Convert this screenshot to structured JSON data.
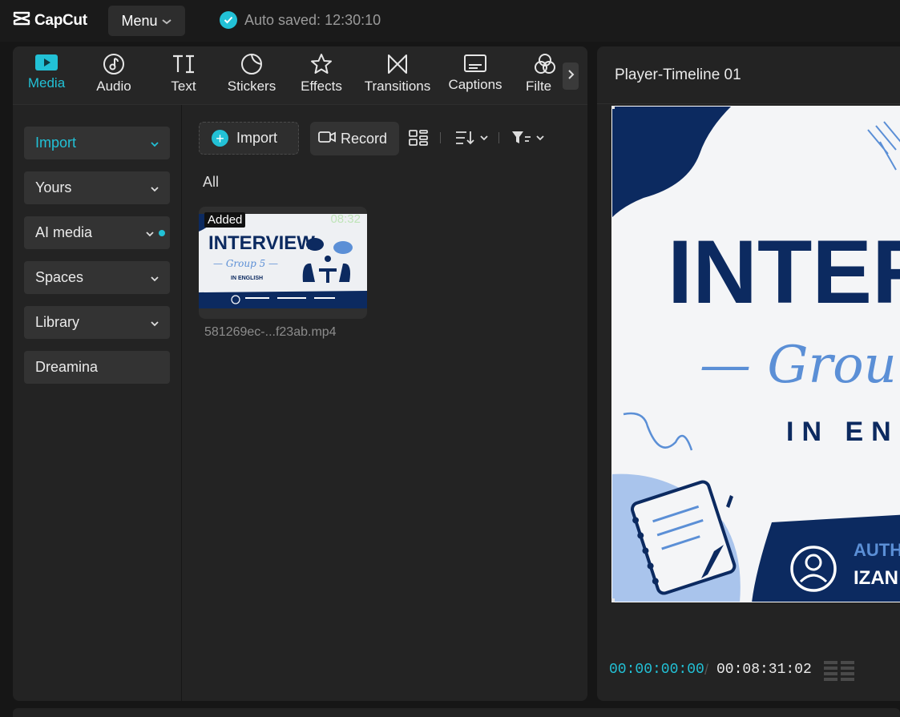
{
  "app": {
    "name": "CapCut"
  },
  "topbar": {
    "menu_label": "Menu",
    "autosave_text": "Auto saved: 12:30:10"
  },
  "toolstrip": {
    "tabs": [
      {
        "label": "Media",
        "icon": "media-icon",
        "active": true
      },
      {
        "label": "Audio",
        "icon": "audio-icon"
      },
      {
        "label": "Text",
        "icon": "text-icon"
      },
      {
        "label": "Stickers",
        "icon": "stickers-icon"
      },
      {
        "label": "Effects",
        "icon": "effects-icon"
      },
      {
        "label": "Transitions",
        "icon": "transitions-icon"
      },
      {
        "label": "Captions",
        "icon": "captions-icon"
      },
      {
        "label": "Filte",
        "icon": "filters-icon"
      }
    ]
  },
  "sidebar": {
    "items": [
      {
        "label": "Import",
        "active": true,
        "has_chevron": true
      },
      {
        "label": "Yours",
        "has_chevron": true
      },
      {
        "label": "AI media",
        "has_chevron": true,
        "has_dot": true
      },
      {
        "label": "Spaces",
        "has_chevron": true
      },
      {
        "label": "Library",
        "has_chevron": true
      },
      {
        "label": "Dreamina",
        "has_chevron": false
      }
    ]
  },
  "media_toolbar": {
    "import_label": "Import",
    "record_label": "Record"
  },
  "media": {
    "filter_label": "All",
    "clips": [
      {
        "badge": "Added",
        "duration": "08:32",
        "filename": "581269ec-...f23ab.mp4",
        "thumb_title": "INTERVIEW",
        "thumb_subtitle": "— Group 5 —",
        "thumb_caption": "IN ENGLISH"
      }
    ]
  },
  "player": {
    "title": "Player-Timeline 01",
    "preview": {
      "headline": "INTER",
      "subline": "— Grou",
      "caption": "IN ENG",
      "author_label": "AUTH",
      "author_name": "IZAN"
    },
    "current_time": "00:00:00:00",
    "separator": "/",
    "total_time": "00:08:31:02"
  },
  "colors": {
    "accent": "#22c1d6",
    "navy": "#0c2a60",
    "light_blue": "#5b8fd6"
  }
}
